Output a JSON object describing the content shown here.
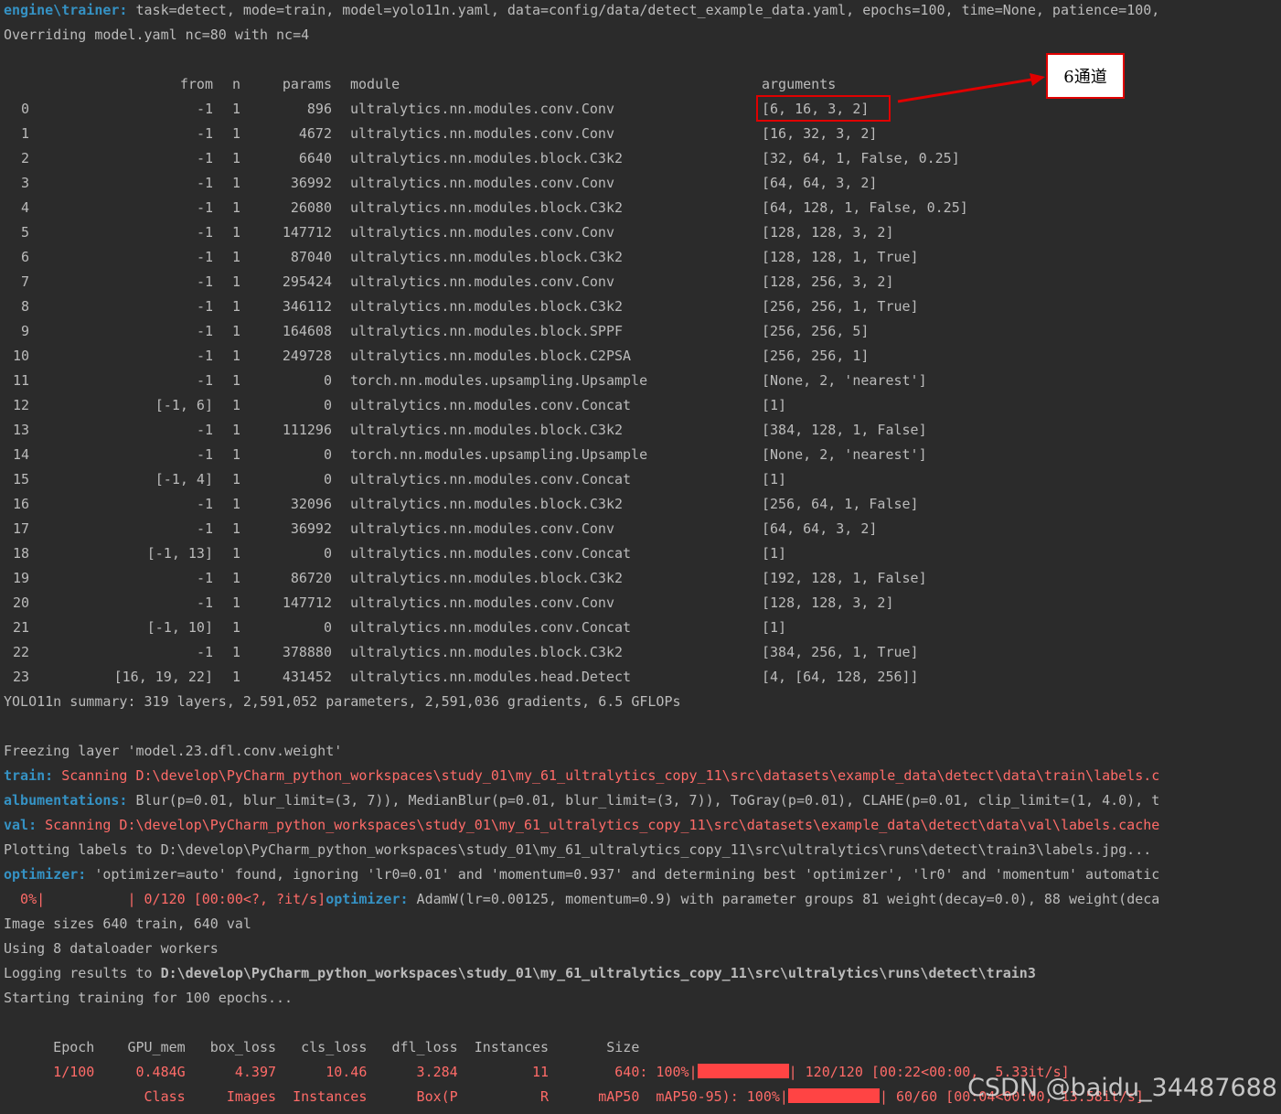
{
  "header": {
    "line1_prefix": "engine\\trainer:",
    "line1_text": " task=detect, mode=train, model=yolo11n.yaml, data=config/data/detect_example_data.yaml, epochs=100, time=None, patience=100,",
    "line2": "Overriding model.yaml nc=80 with nc=4"
  },
  "table": {
    "columns": {
      "from": "from",
      "n": "n",
      "params": "params",
      "module": "module",
      "arguments": "arguments"
    },
    "rows": [
      {
        "idx": "0",
        "from": "-1",
        "n": "1",
        "params": "896",
        "module": "ultralytics.nn.modules.conv.Conv",
        "args": "[6, 16, 3, 2]"
      },
      {
        "idx": "1",
        "from": "-1",
        "n": "1",
        "params": "4672",
        "module": "ultralytics.nn.modules.conv.Conv",
        "args": "[16, 32, 3, 2]"
      },
      {
        "idx": "2",
        "from": "-1",
        "n": "1",
        "params": "6640",
        "module": "ultralytics.nn.modules.block.C3k2",
        "args": "[32, 64, 1, False, 0.25]"
      },
      {
        "idx": "3",
        "from": "-1",
        "n": "1",
        "params": "36992",
        "module": "ultralytics.nn.modules.conv.Conv",
        "args": "[64, 64, 3, 2]"
      },
      {
        "idx": "4",
        "from": "-1",
        "n": "1",
        "params": "26080",
        "module": "ultralytics.nn.modules.block.C3k2",
        "args": "[64, 128, 1, False, 0.25]"
      },
      {
        "idx": "5",
        "from": "-1",
        "n": "1",
        "params": "147712",
        "module": "ultralytics.nn.modules.conv.Conv",
        "args": "[128, 128, 3, 2]"
      },
      {
        "idx": "6",
        "from": "-1",
        "n": "1",
        "params": "87040",
        "module": "ultralytics.nn.modules.block.C3k2",
        "args": "[128, 128, 1, True]"
      },
      {
        "idx": "7",
        "from": "-1",
        "n": "1",
        "params": "295424",
        "module": "ultralytics.nn.modules.conv.Conv",
        "args": "[128, 256, 3, 2]"
      },
      {
        "idx": "8",
        "from": "-1",
        "n": "1",
        "params": "346112",
        "module": "ultralytics.nn.modules.block.C3k2",
        "args": "[256, 256, 1, True]"
      },
      {
        "idx": "9",
        "from": "-1",
        "n": "1",
        "params": "164608",
        "module": "ultralytics.nn.modules.block.SPPF",
        "args": "[256, 256, 5]"
      },
      {
        "idx": "10",
        "from": "-1",
        "n": "1",
        "params": "249728",
        "module": "ultralytics.nn.modules.block.C2PSA",
        "args": "[256, 256, 1]"
      },
      {
        "idx": "11",
        "from": "-1",
        "n": "1",
        "params": "0",
        "module": "torch.nn.modules.upsampling.Upsample",
        "args": "[None, 2, 'nearest']"
      },
      {
        "idx": "12",
        "from": "[-1, 6]",
        "n": "1",
        "params": "0",
        "module": "ultralytics.nn.modules.conv.Concat",
        "args": "[1]"
      },
      {
        "idx": "13",
        "from": "-1",
        "n": "1",
        "params": "111296",
        "module": "ultralytics.nn.modules.block.C3k2",
        "args": "[384, 128, 1, False]"
      },
      {
        "idx": "14",
        "from": "-1",
        "n": "1",
        "params": "0",
        "module": "torch.nn.modules.upsampling.Upsample",
        "args": "[None, 2, 'nearest']"
      },
      {
        "idx": "15",
        "from": "[-1, 4]",
        "n": "1",
        "params": "0",
        "module": "ultralytics.nn.modules.conv.Concat",
        "args": "[1]"
      },
      {
        "idx": "16",
        "from": "-1",
        "n": "1",
        "params": "32096",
        "module": "ultralytics.nn.modules.block.C3k2",
        "args": "[256, 64, 1, False]"
      },
      {
        "idx": "17",
        "from": "-1",
        "n": "1",
        "params": "36992",
        "module": "ultralytics.nn.modules.conv.Conv",
        "args": "[64, 64, 3, 2]"
      },
      {
        "idx": "18",
        "from": "[-1, 13]",
        "n": "1",
        "params": "0",
        "module": "ultralytics.nn.modules.conv.Concat",
        "args": "[1]"
      },
      {
        "idx": "19",
        "from": "-1",
        "n": "1",
        "params": "86720",
        "module": "ultralytics.nn.modules.block.C3k2",
        "args": "[192, 128, 1, False]"
      },
      {
        "idx": "20",
        "from": "-1",
        "n": "1",
        "params": "147712",
        "module": "ultralytics.nn.modules.conv.Conv",
        "args": "[128, 128, 3, 2]"
      },
      {
        "idx": "21",
        "from": "[-1, 10]",
        "n": "1",
        "params": "0",
        "module": "ultralytics.nn.modules.conv.Concat",
        "args": "[1]"
      },
      {
        "idx": "22",
        "from": "-1",
        "n": "1",
        "params": "378880",
        "module": "ultralytics.nn.modules.block.C3k2",
        "args": "[384, 256, 1, True]"
      },
      {
        "idx": "23",
        "from": "[16, 19, 22]",
        "n": "1",
        "params": "431452",
        "module": "ultralytics.nn.modules.head.Detect",
        "args": "[4, [64, 128, 256]]"
      }
    ]
  },
  "summary": "YOLO11n summary: 319 layers, 2,591,052 parameters, 2,591,036 gradients, 6.5 GFLOPs",
  "freezing": "Freezing layer 'model.23.dfl.conv.weight'",
  "train_scan": {
    "prefix": "train:",
    "text": " Scanning D:\\develop\\PyCharm_python_workspaces\\study_01\\my_61_ultralytics_copy_11\\src\\datasets\\example_data\\detect\\data\\train\\labels.c"
  },
  "albumentations": {
    "prefix": "albumentations:",
    "text": " Blur(p=0.01, blur_limit=(3, 7)), MedianBlur(p=0.01, blur_limit=(3, 7)), ToGray(p=0.01), CLAHE(p=0.01, clip_limit=(1, 4.0), t"
  },
  "val_scan": {
    "prefix": "val:",
    "text": " Scanning D:\\develop\\PyCharm_python_workspaces\\study_01\\my_61_ultralytics_copy_11\\src\\datasets\\example_data\\detect\\data\\val\\labels.cache"
  },
  "plotting": "Plotting labels to D:\\develop\\PyCharm_python_workspaces\\study_01\\my_61_ultralytics_copy_11\\src\\ultralytics\\runs\\detect\\train3\\labels.jpg...",
  "optimizer1": {
    "prefix": "optimizer:",
    "text": " 'optimizer=auto' found, ignoring 'lr0=0.01' and 'momentum=0.937' and determining best 'optimizer', 'lr0' and 'momentum' automatic"
  },
  "progress_line": {
    "red": "  0%|          | 0/120 [00:00<?, ?it/s]",
    "prefix": "optimizer:",
    "text": " AdamW(lr=0.00125, momentum=0.9) with parameter groups 81 weight(decay=0.0), 88 weight(deca"
  },
  "image_sizes": "Image sizes 640 train, 640 val",
  "workers": "Using 8 dataloader workers",
  "logging": {
    "prefix": "Logging results to ",
    "path": "D:\\develop\\PyCharm_python_workspaces\\study_01\\my_61_ultralytics_copy_11\\src\\ultralytics\\runs\\detect\\train3"
  },
  "starting": "Starting training for 100 epochs...",
  "train_header": "      Epoch    GPU_mem   box_loss   cls_loss   dfl_loss  Instances       Size",
  "epoch_line": {
    "left": "      1/100     0.484G      4.397      10.46      3.284         11        640: 100%|",
    "right": "| 120/120 [00:22<00:00,  5.33it/s]",
    "progress": 1.0
  },
  "val_line": {
    "left": "                 Class     Images  Instances      Box(P          R      mAP50  mAP50-95): 100%|",
    "right": "| 60/60 [00:04<00:00, 13.58it/s]",
    "progress": 1.0
  },
  "annotation": {
    "label": "6通道",
    "color": "#e00000"
  },
  "watermark": "CSDN @baidu_34487688",
  "colors": {
    "background": "#2b2b2b",
    "text": "#bbbbbb",
    "prefix_blue": "#3592c4",
    "error_red": "#ff6b68"
  }
}
